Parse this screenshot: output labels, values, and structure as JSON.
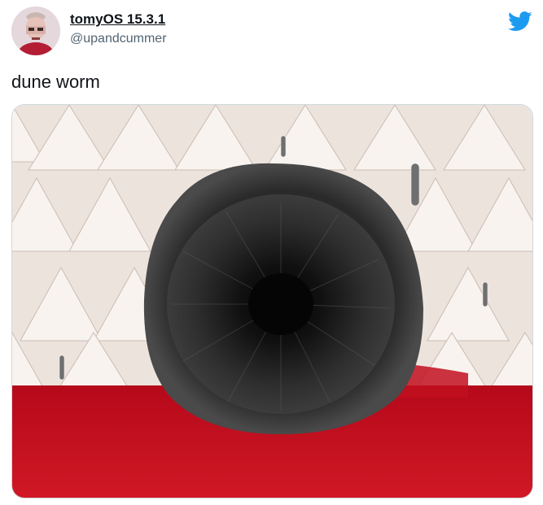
{
  "tweet": {
    "display_name": "tomyOS 15.3.1",
    "handle": "@upandcummer",
    "text": "dune worm"
  },
  "icons": {
    "brand": "twitter-bird-icon"
  },
  "colors": {
    "twitter_blue": "#1d9bf0",
    "text_primary": "#0f1419",
    "text_secondary": "#536471",
    "carpet_red": "#c8101f",
    "wall_cream": "#ede3dd"
  }
}
